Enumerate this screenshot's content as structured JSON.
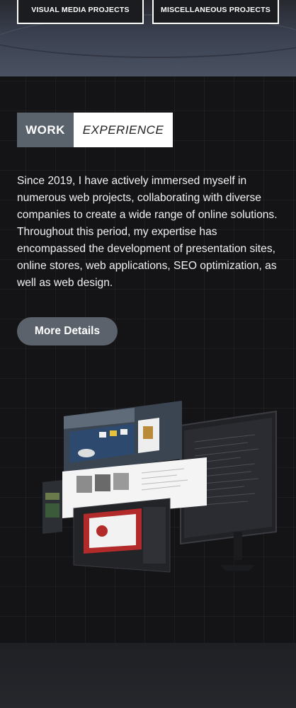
{
  "projects": {
    "visual_media": "VISUAL MEDIA PROJECTS",
    "miscellaneous": "MISCELLANEOUS PROJECTS"
  },
  "experience": {
    "heading_part1": "WORK",
    "heading_part2": "EXPERIENCE",
    "description": "Since 2019, I have actively immersed myself in numerous web projects, collaborating with diverse companies to create a wide range of online solutions. Throughout this period, my expertise has encompassed the development of presentation sites, online stores, web applications, SEO optimization, as well as web design.",
    "button_label": "More Details"
  },
  "colors": {
    "heading_dark": "#5a626c",
    "button_bg": "#5b626b",
    "page_bg": "#141416"
  }
}
